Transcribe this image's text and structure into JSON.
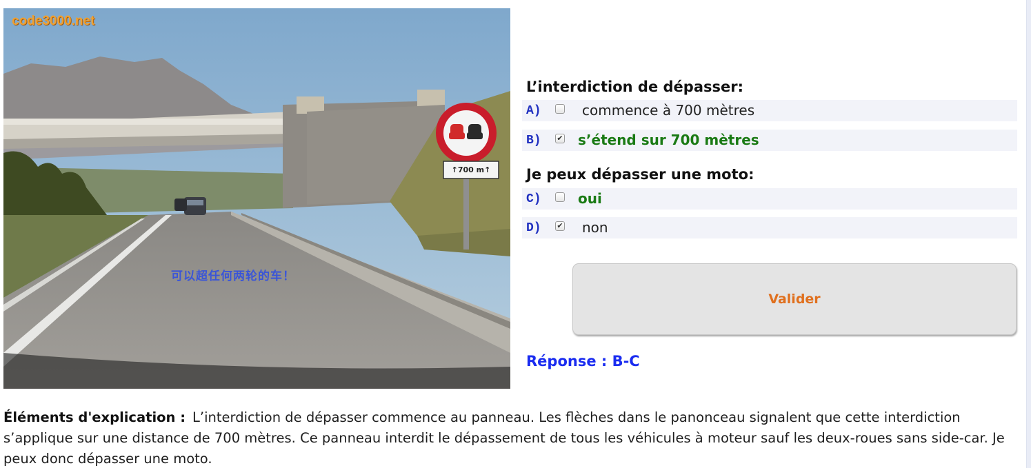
{
  "photo": {
    "watermark": "code3000.net",
    "caption": "可以超任何两轮的车！",
    "sign_plate": "↑700 m↑"
  },
  "questions": [
    {
      "text": "L’interdiction de dépasser:",
      "options": [
        {
          "letter": "A)",
          "text": "commence à 700 mètres",
          "checked": false,
          "style": "normal"
        },
        {
          "letter": "B)",
          "text": "s’étend sur 700 mètres",
          "checked": true,
          "style": "correct"
        }
      ]
    },
    {
      "text": "Je peux dépasser une moto:",
      "options": [
        {
          "letter": "C)",
          "text": "oui",
          "checked": false,
          "style": "correct"
        },
        {
          "letter": "D)",
          "text": "non",
          "checked": true,
          "style": "normal"
        }
      ]
    }
  ],
  "checkmark": "✔",
  "validate_label": "Valider",
  "answer": "Réponse : B-C",
  "explanation": {
    "label": "Éléments d'explication :",
    "text": "L’interdiction de dépasser commence au panneau. Les flèches dans le panonceau signalent que cette interdiction s’applique sur une distance de 700 mètres. Ce panneau interdit le dépassement de tous les véhicules à moteur sauf les deux-roues sans side-car. Je peux donc dépasser une moto."
  },
  "colors": {
    "option_letter": "#2030c0",
    "correct_text": "#1a7a14",
    "validate_text": "#e0701e",
    "answer_text": "#1a2cf0",
    "caption_text": "#3a55d8",
    "watermark": "#f0a030"
  }
}
